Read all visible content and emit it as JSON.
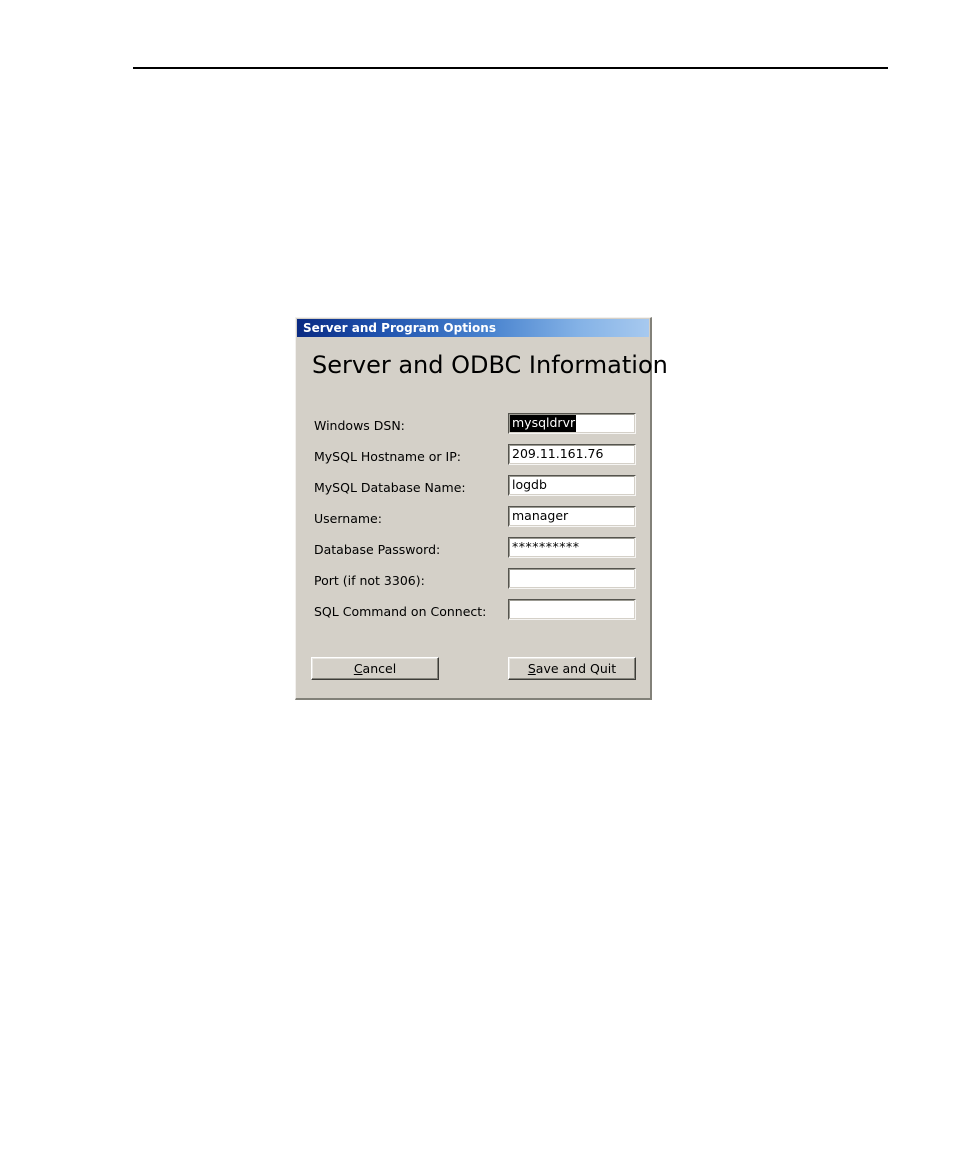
{
  "page": {
    "background_color": "#ffffff",
    "rule_color": "#000000"
  },
  "dialog": {
    "titlebar": {
      "title": "Server and Program Options",
      "gradient_start": "#0a2a82",
      "gradient_end": "#a7c9ef",
      "text_color": "#ffffff"
    },
    "heading": "Server and ODBC Information",
    "background_color": "#d4d0c8",
    "fields": [
      {
        "label": "Windows DSN:",
        "value": "mysqldrvr",
        "placeholder": "",
        "selected": true,
        "masked": false
      },
      {
        "label": "MySQL Hostname or IP:",
        "value": "209.11.161.76",
        "placeholder": "",
        "selected": false,
        "masked": false
      },
      {
        "label": "MySQL Database Name:",
        "value": "logdb",
        "placeholder": "",
        "selected": false,
        "masked": false
      },
      {
        "label": "Username:",
        "value": "manager",
        "placeholder": "",
        "selected": false,
        "masked": false
      },
      {
        "label": "Database Password:",
        "value": "**********",
        "placeholder": "",
        "selected": false,
        "masked": true
      },
      {
        "label": "Port (if not 3306):",
        "value": "",
        "placeholder": "",
        "selected": false,
        "masked": false
      },
      {
        "label": "SQL Command on Connect:",
        "value": "",
        "placeholder": "",
        "selected": false,
        "masked": false
      }
    ],
    "buttons": {
      "cancel": {
        "label": "Cancel",
        "accelerator": "C",
        "accel_prefix": "",
        "accel_suffix": "ancel"
      },
      "save_and_quit": {
        "label": "Save and Quit",
        "accelerator": "S",
        "accel_prefix": "",
        "accel_suffix": "ave and Quit"
      }
    }
  }
}
